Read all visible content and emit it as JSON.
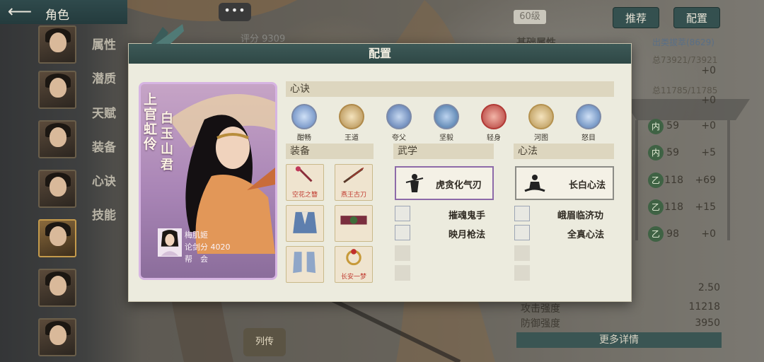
{
  "header": {
    "title": "角色",
    "back_icon": "back-arrow-icon"
  },
  "chat": {
    "label": "•••"
  },
  "left_menu": [
    "属性",
    "潜质",
    "天赋",
    "装备",
    "心诀",
    "技能"
  ],
  "background": {
    "score_ghost": "评分 9309",
    "level": "60级",
    "buttons": {
      "recommend": "推荐",
      "config": "配置"
    },
    "section_heading": "基础属性",
    "link_text": "出类拔萃(8629)",
    "rows": [
      {
        "text": "总73921/73921",
        "delta": "+0"
      },
      {
        "text": "总11785/11785",
        "delta": "+0"
      }
    ],
    "stats": [
      {
        "badge": "内",
        "value": "59",
        "delta": "+0"
      },
      {
        "badge": "内",
        "value": "59",
        "delta": "+5"
      },
      {
        "badge": "乙",
        "value": "118",
        "delta": "+69"
      },
      {
        "badge": "乙",
        "value": "118",
        "delta": "+15"
      },
      {
        "badge": "乙",
        "value": "98",
        "delta": "+0"
      }
    ],
    "attrs": [
      {
        "label": "",
        "value": "2.50"
      },
      {
        "label": "攻击强度",
        "value": "11218"
      },
      {
        "label": "防御强度",
        "value": "3950"
      }
    ],
    "more_button": "更多详情",
    "scroll_button": "列传"
  },
  "modal": {
    "title": "配置",
    "card": {
      "name": "上官虹伶",
      "title": "白玉山君",
      "player_name": "梅肌姬",
      "score_label": "论剑分",
      "score": "4020",
      "guild_label": "帮　会"
    },
    "xinjue_label": "心诀",
    "skills": [
      {
        "label": "酣畅",
        "color": "#5b7fb9"
      },
      {
        "label": "王道",
        "color": "#b08a4a"
      },
      {
        "label": "夸父",
        "color": "#4d6fa8"
      },
      {
        "label": "坚毅",
        "color": "#3f6ea0"
      },
      {
        "label": "轻身",
        "color": "#b23a36"
      },
      {
        "label": "河图",
        "color": "#b5924f"
      },
      {
        "label": "怒目",
        "color": "#4f78b0"
      }
    ],
    "equip_label": "装备",
    "equips": [
      {
        "tag": "空花之簪"
      },
      {
        "tag": "燕王古刀"
      },
      {
        "tag": ""
      },
      {
        "tag": ""
      },
      {
        "tag": ""
      },
      {
        "tag": "长安一梦"
      }
    ],
    "wuxue_label": "武学",
    "wuxue_main": "虎贪化气刃",
    "wuxue_subs": [
      "摧魂鬼手",
      "映月枪法"
    ],
    "xinfa_label": "心法",
    "xinfa_main": "长白心法",
    "xinfa_subs": [
      "峨眉临济功",
      "全真心法"
    ]
  }
}
